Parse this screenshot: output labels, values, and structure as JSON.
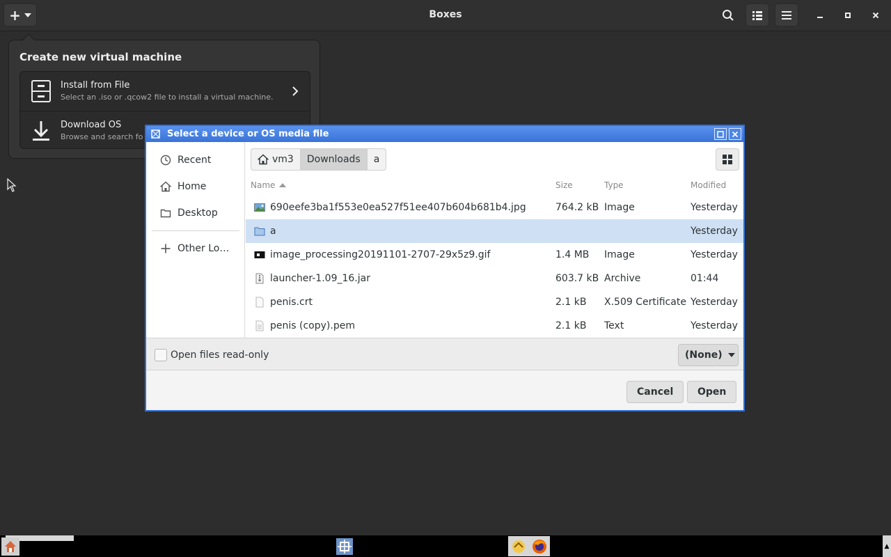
{
  "app": {
    "title": "Boxes"
  },
  "popover": {
    "title": "Create new virtual machine",
    "items": [
      {
        "title": "Install from File",
        "subtitle": "Select an .iso or .qcow2 file to install a virtual machine."
      },
      {
        "title": "Download OS",
        "subtitle": "Browse and search fo"
      }
    ]
  },
  "dialog": {
    "title": "Select a device or OS media file",
    "sidebar": [
      {
        "label": "Recent",
        "icon": "clock-icon"
      },
      {
        "label": "Home",
        "icon": "home-icon"
      },
      {
        "label": "Desktop",
        "icon": "folder-icon"
      },
      {
        "label": "Other Lo…",
        "icon": "plus-icon"
      }
    ],
    "path": [
      "vm3",
      "Downloads",
      "a"
    ],
    "columns": {
      "name": "Name",
      "size": "Size",
      "type": "Type",
      "modified": "Modified"
    },
    "files": [
      {
        "name": "690eefe3ba1f553e0ea527f51ee407b604b681b4.jpg",
        "size": "764.2 kB",
        "type": "Image",
        "modified": "Yesterday",
        "icon": "image-file-icon",
        "selected": false
      },
      {
        "name": "a",
        "size": "",
        "type": "",
        "modified": "Yesterday",
        "icon": "folder-icon",
        "selected": true
      },
      {
        "name": "image_processing20191101-2707-29x5z9.gif",
        "size": "1.4 MB",
        "type": "Image",
        "modified": "Yesterday",
        "icon": "gif-file-icon",
        "selected": false
      },
      {
        "name": "launcher-1.09_16.jar",
        "size": "603.7 kB",
        "type": "Archive",
        "modified": "01:44",
        "icon": "archive-file-icon",
        "selected": false
      },
      {
        "name": "penis.crt",
        "size": "2.1 kB",
        "type": "X.509 Certificate",
        "modified": "Yesterday",
        "icon": "certificate-file-icon",
        "selected": false
      },
      {
        "name": "penis (copy).pem",
        "size": "2.1 kB",
        "type": "Text",
        "modified": "Yesterday",
        "icon": "text-file-icon",
        "selected": false
      }
    ],
    "readonly_label": "Open files read-only",
    "filter_label": "(None)",
    "cancel_label": "Cancel",
    "open_label": "Open"
  },
  "colors": {
    "titlebar": "#3a73d8",
    "selection": "#cfe0f4",
    "background": "#2d2d2d"
  }
}
